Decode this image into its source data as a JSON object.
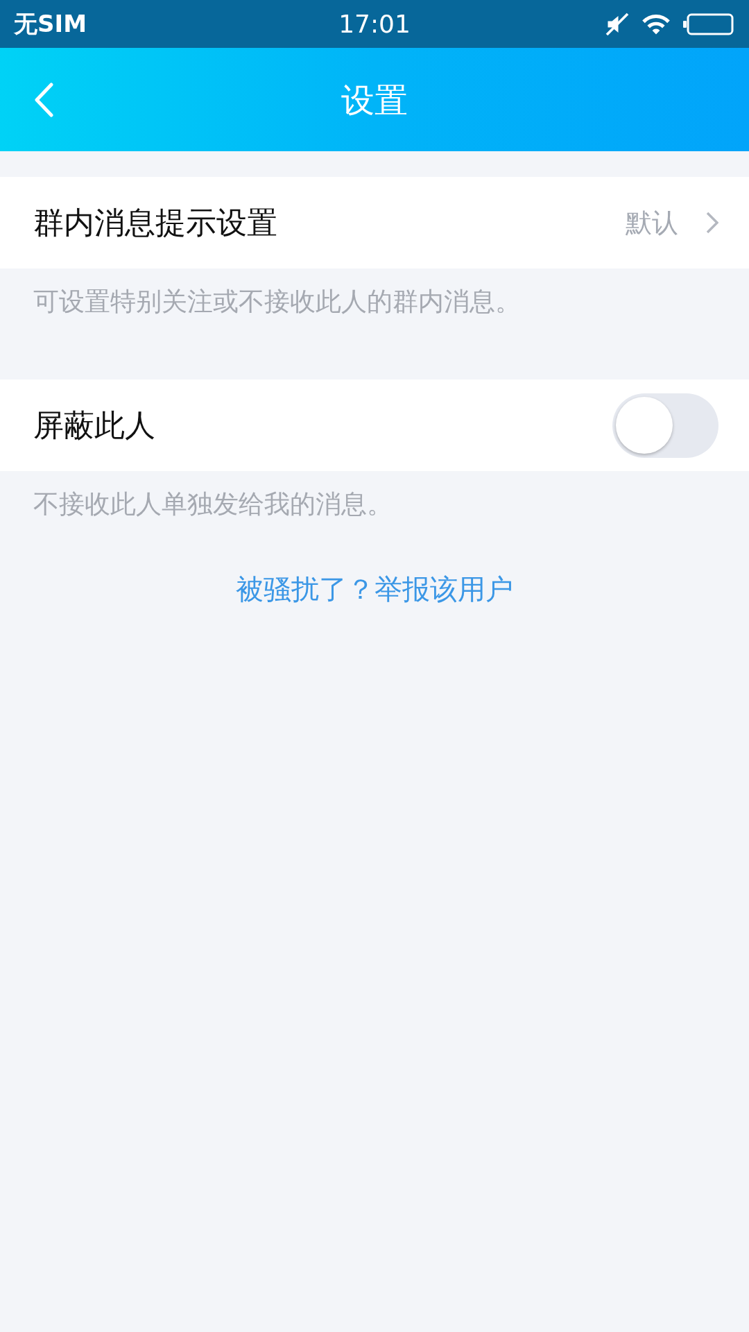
{
  "status_bar": {
    "carrier": "无SIM",
    "time": "17:01"
  },
  "header": {
    "title": "设置"
  },
  "sections": [
    {
      "kind": "link",
      "label": "群内消息提示设置",
      "value": "默认",
      "hint": "可设置特别关注或不接收此人的群内消息。"
    },
    {
      "kind": "toggle",
      "label": "屏蔽此人",
      "on": false,
      "hint": "不接收此人单独发给我的消息。"
    }
  ],
  "report_link": "被骚扰了？举报该用户"
}
